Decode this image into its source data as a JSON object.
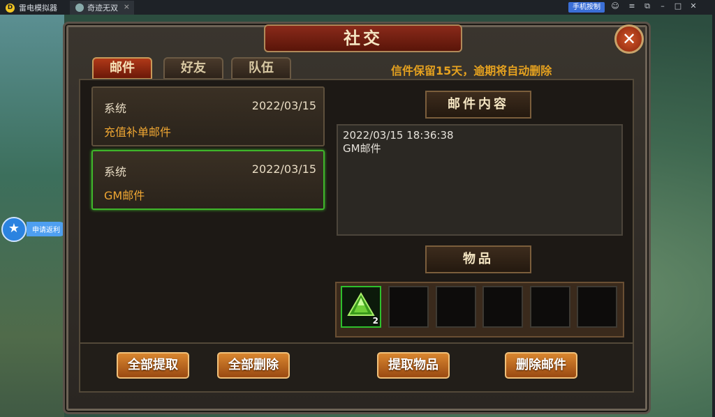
{
  "emulator": {
    "app_name": "雷电模拟器",
    "tab_title": "奇迹无双",
    "tab_close": "×",
    "control_button": "手机按制"
  },
  "side_helper": {
    "label": "申请返利"
  },
  "window": {
    "title": "社交",
    "close_symbol": "✕"
  },
  "tabs": [
    {
      "label": "邮件",
      "active": true
    },
    {
      "label": "好友",
      "active": false
    },
    {
      "label": "队伍",
      "active": false
    }
  ],
  "notice": "信件保留15天，逾期将自动删除",
  "mails": [
    {
      "sender": "系统",
      "date": "2022/03/15",
      "subject": "充值补单邮件",
      "selected": false
    },
    {
      "sender": "系统",
      "date": "2022/03/15",
      "subject": "GM邮件",
      "selected": true
    }
  ],
  "mail_content": {
    "header": "邮件内容",
    "lines": [
      "2022/03/15 18:36:38",
      "GM邮件"
    ]
  },
  "items": {
    "header": "物品",
    "slots": [
      {
        "icon": "green-gem-icon",
        "quantity": "2"
      },
      null,
      null,
      null,
      null,
      null
    ]
  },
  "buttons": {
    "take_all": "全部提取",
    "delete_all": "全部删除",
    "take_items": "提取物品",
    "delete_mail": "删除邮件"
  },
  "colors": {
    "accent_orange": "#e6a21f",
    "selected_green": "#3fb52b"
  }
}
